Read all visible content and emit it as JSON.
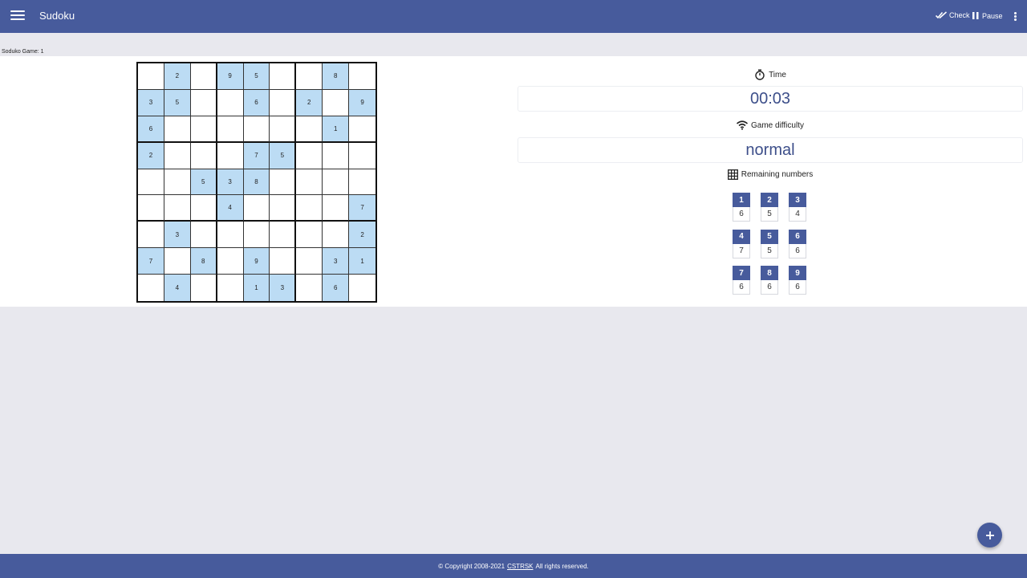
{
  "app": {
    "title": "Sudoku"
  },
  "toolbar": {
    "check_label": "Check",
    "pause_label": "Pause"
  },
  "game_label": "Soduko Game: 1",
  "board": [
    [
      "",
      "2",
      "",
      "9",
      "5",
      "",
      "",
      "8",
      ""
    ],
    [
      "3",
      "5",
      "",
      "",
      "6",
      "",
      "2",
      "",
      "9"
    ],
    [
      "6",
      "",
      "",
      "",
      "",
      "",
      "",
      "1",
      ""
    ],
    [
      "2",
      "",
      "",
      "",
      "7",
      "5",
      "",
      "",
      ""
    ],
    [
      "",
      "",
      "5",
      "3",
      "8",
      "",
      "",
      "",
      ""
    ],
    [
      "",
      "",
      "",
      "4",
      "",
      "",
      "",
      "",
      "7"
    ],
    [
      "",
      "3",
      "",
      "",
      "",
      "",
      "",
      "",
      "2"
    ],
    [
      "7",
      "",
      "8",
      "",
      "9",
      "",
      "",
      "3",
      "1"
    ],
    [
      "",
      "4",
      "",
      "",
      "1",
      "3",
      "",
      "6",
      ""
    ]
  ],
  "time": {
    "label": "Time",
    "value": "00:03"
  },
  "difficulty": {
    "label": "Game difficulty",
    "value": "normal"
  },
  "remaining": {
    "label": "Remaining numbers",
    "items": [
      {
        "number": "1",
        "count": "6"
      },
      {
        "number": "2",
        "count": "5"
      },
      {
        "number": "3",
        "count": "4"
      },
      {
        "number": "4",
        "count": "7"
      },
      {
        "number": "5",
        "count": "5"
      },
      {
        "number": "6",
        "count": "6"
      },
      {
        "number": "7",
        "count": "6"
      },
      {
        "number": "8",
        "count": "6"
      },
      {
        "number": "9",
        "count": "6"
      }
    ]
  },
  "footer": {
    "prefix": "© Copyright 2008-2021",
    "link": "CSTRSK",
    "suffix": "All rights reserved."
  },
  "colors": {
    "primary": "#475b9c",
    "given_cell": "#bcdcf4",
    "value_text": "#3d4f8a",
    "background": "#e8e8ee"
  },
  "icons": {
    "menu": "hamburger-menu-icon",
    "check": "double-check-icon",
    "pause": "pause-icon",
    "more": "more-vert-icon",
    "time": "timer-icon",
    "difficulty": "wifi-signal-icon",
    "remaining": "grid-icon",
    "fab": "plus-icon"
  }
}
